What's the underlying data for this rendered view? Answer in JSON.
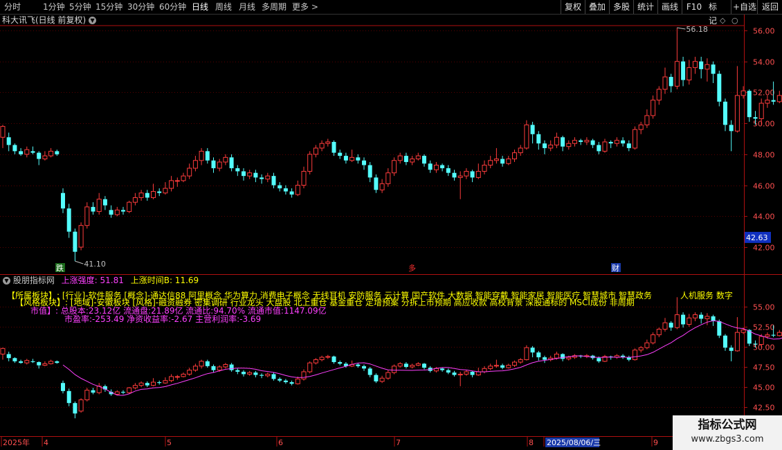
{
  "toolbar": {
    "periods": [
      "分时",
      "1分钟",
      "5分钟",
      "15分钟",
      "30分钟",
      "60分钟",
      "日线",
      "周线",
      "月线",
      "多周期",
      "更多 >"
    ],
    "active_period": "日线",
    "right_buttons": [
      "复权",
      "叠加",
      "多股",
      "统计",
      "画线",
      "F10",
      "+自选",
      "返回"
    ],
    "mark_label": "标记"
  },
  "stock_title": "科大讯飞(日线 前复权)",
  "price_axis": [
    "56.00",
    "54.00",
    "52.00",
    "50.00",
    "48.00",
    "46.00",
    "44.00",
    "42.00"
  ],
  "current_price": "42.63",
  "high_label": "56.18",
  "low_label": "41.10",
  "markers": {
    "die": "跌",
    "lang": "多",
    "cai": "财"
  },
  "indicator": {
    "name": "股朋指标网",
    "v1_label": "上涨强度: 51.81",
    "v2_label": "上涨时间B: 11.69"
  },
  "info": {
    "line1_label": "【所属板块】:",
    "line1_text": "[行业]-软件服务 [概念]-通达信88 阿里概念 华为算力 消费电子概念 无线耳机 安防服务 云计算 国产软件 大数据 智能穿戴 智能家居 智能医疗 智慧城市 智慧政务",
    "line1_right": "人机服务 数字",
    "line2_label": "【风格板块】:",
    "line2_text": "[地域]-安徽板块 [风格]-融资融券 密集调研 行业龙头 大盘股 北上重仓 基金重仓 定增预案 分拆上市预期 高应收款 高校背景 深股通标的 MSCI成份 非周期",
    "line3_label": "市值】:",
    "line3_text": "总股本:23.12亿 流通盘:21.89亿 流通比:94.70% 流通市值:1147.09亿",
    "line4_text": "市盈率:-253.49 净资收益率:-2.67 主营利润率:-3.69"
  },
  "indicator_axis": [
    "55.00",
    "52.50",
    "50.00",
    "47.50",
    "45.00",
    "42.50"
  ],
  "dates": [
    "2025年",
    "4",
    "5",
    "6",
    "7",
    "8",
    "2025/08/06/三",
    "9"
  ],
  "watermark": {
    "title": "指标公式网",
    "url": "www.zbgs3.com"
  },
  "colors": {
    "up": "#ff3c3c",
    "down": "#54fcfc",
    "ma": "#ff40ff",
    "axis": "#b01010",
    "yellow": "#ffff00"
  },
  "chart_data": {
    "type": "candlestick",
    "ylim": [
      41.0,
      56.7
    ],
    "candles": [
      [
        49.1,
        49.8,
        49.9,
        48.4
      ],
      [
        49.1,
        48.6,
        49.4,
        48.2
      ],
      [
        48.6,
        48.2,
        48.7,
        48.0
      ],
      [
        48.2,
        48.0,
        48.4,
        47.9
      ],
      [
        48.0,
        48.3,
        48.5,
        47.8
      ],
      [
        48.2,
        48.1,
        48.5,
        48.0
      ],
      [
        48.1,
        47.7,
        48.2,
        47.3
      ],
      [
        47.7,
        47.9,
        48.2,
        47.6
      ],
      [
        47.9,
        48.2,
        48.4,
        47.8
      ],
      [
        48.2,
        48.0,
        48.3,
        47.9
      ],
      [
        45.5,
        44.5,
        45.8,
        44.2
      ],
      [
        44.5,
        43.0,
        44.8,
        42.6
      ],
      [
        43.0,
        41.7,
        43.2,
        41.1
      ],
      [
        42.0,
        43.4,
        43.6,
        41.8
      ],
      [
        43.4,
        44.6,
        44.9,
        43.2
      ],
      [
        44.6,
        44.3,
        44.9,
        44.1
      ],
      [
        44.3,
        45.1,
        45.5,
        44.1
      ],
      [
        45.1,
        44.7,
        45.3,
        44.4
      ],
      [
        44.4,
        44.1,
        44.7,
        43.9
      ],
      [
        44.1,
        44.4,
        44.6,
        44.0
      ],
      [
        44.4,
        44.3,
        44.6,
        44.1
      ],
      [
        44.3,
        44.9,
        45.0,
        44.2
      ],
      [
        44.9,
        45.2,
        45.5,
        44.7
      ],
      [
        45.2,
        45.5,
        45.7,
        45.0
      ],
      [
        45.5,
        45.2,
        45.7,
        45.0
      ],
      [
        45.2,
        45.6,
        46.1,
        45.1
      ],
      [
        45.6,
        45.5,
        45.8,
        45.3
      ],
      [
        45.5,
        45.8,
        46.2,
        45.4
      ],
      [
        45.8,
        46.3,
        46.6,
        45.6
      ],
      [
        46.3,
        46.3,
        46.5,
        45.9
      ],
      [
        46.3,
        46.6,
        46.8,
        46.2
      ],
      [
        46.6,
        47.1,
        47.4,
        46.4
      ],
      [
        47.1,
        47.6,
        47.9,
        46.9
      ],
      [
        47.6,
        48.2,
        48.4,
        47.3
      ],
      [
        48.2,
        47.6,
        48.4,
        47.4
      ],
      [
        47.6,
        47.1,
        47.8,
        46.8
      ],
      [
        47.1,
        47.5,
        47.7,
        46.9
      ],
      [
        47.5,
        47.8,
        48.0,
        47.3
      ],
      [
        47.8,
        47.1,
        48.0,
        46.9
      ],
      [
        47.1,
        46.9,
        47.3,
        46.6
      ],
      [
        46.9,
        46.6,
        47.1,
        46.3
      ],
      [
        46.6,
        46.8,
        47.0,
        46.4
      ],
      [
        46.8,
        46.5,
        47.0,
        46.2
      ],
      [
        46.5,
        46.4,
        46.7,
        46.1
      ],
      [
        46.4,
        46.6,
        46.8,
        46.2
      ],
      [
        46.6,
        46.0,
        46.8,
        45.8
      ],
      [
        46.0,
        45.8,
        46.2,
        45.6
      ],
      [
        45.8,
        45.6,
        46.0,
        45.4
      ],
      [
        45.6,
        45.4,
        45.8,
        45.2
      ],
      [
        45.4,
        46.0,
        46.3,
        45.3
      ],
      [
        46.0,
        46.9,
        47.2,
        45.8
      ],
      [
        46.9,
        48.0,
        48.2,
        46.7
      ],
      [
        48.0,
        48.4,
        48.6,
        47.8
      ],
      [
        48.4,
        48.7,
        48.9,
        48.2
      ],
      [
        48.7,
        48.8,
        49.0,
        48.5
      ],
      [
        48.8,
        48.1,
        48.9,
        47.9
      ],
      [
        48.1,
        47.9,
        48.3,
        47.7
      ],
      [
        47.9,
        47.6,
        48.1,
        47.4
      ],
      [
        47.6,
        47.8,
        48.3,
        47.5
      ],
      [
        47.8,
        47.6,
        48.0,
        47.4
      ],
      [
        47.6,
        47.3,
        47.8,
        47.0
      ],
      [
        47.3,
        46.5,
        47.5,
        46.2
      ],
      [
        46.5,
        45.7,
        46.7,
        45.5
      ],
      [
        45.7,
        46.1,
        46.4,
        45.5
      ],
      [
        46.1,
        46.8,
        47.1,
        45.9
      ],
      [
        46.8,
        47.6,
        47.8,
        46.6
      ],
      [
        47.6,
        47.9,
        48.1,
        47.4
      ],
      [
        47.9,
        47.5,
        48.1,
        47.3
      ],
      [
        47.5,
        47.7,
        47.9,
        47.3
      ],
      [
        47.7,
        47.9,
        48.1,
        47.6
      ],
      [
        47.9,
        47.4,
        48.0,
        47.2
      ],
      [
        47.4,
        47.0,
        47.6,
        46.8
      ],
      [
        47.0,
        47.3,
        47.5,
        46.8
      ],
      [
        47.3,
        47.1,
        47.4,
        46.9
      ],
      [
        47.1,
        46.8,
        47.3,
        46.6
      ],
      [
        46.8,
        46.5,
        47.0,
        46.3
      ],
      [
        46.5,
        46.6,
        46.9,
        45.1
      ],
      [
        46.6,
        46.9,
        47.1,
        46.4
      ],
      [
        46.9,
        46.5,
        47.0,
        46.2
      ],
      [
        46.5,
        46.9,
        47.4,
        46.4
      ],
      [
        46.9,
        47.3,
        47.6,
        46.7
      ],
      [
        47.3,
        47.6,
        47.9,
        47.1
      ],
      [
        47.6,
        47.7,
        48.4,
        47.4
      ],
      [
        47.7,
        47.4,
        47.9,
        47.2
      ],
      [
        47.4,
        47.7,
        47.9,
        47.3
      ],
      [
        47.7,
        48.1,
        48.3,
        47.5
      ],
      [
        48.1,
        48.4,
        48.6,
        47.9
      ],
      [
        48.4,
        49.9,
        50.2,
        48.3
      ],
      [
        49.9,
        49.3,
        50.1,
        48.7
      ],
      [
        49.3,
        48.7,
        49.5,
        48.3
      ],
      [
        48.7,
        48.4,
        48.9,
        48.0
      ],
      [
        48.4,
        48.6,
        48.9,
        48.2
      ],
      [
        48.6,
        49.1,
        49.4,
        48.4
      ],
      [
        49.1,
        48.5,
        49.2,
        48.2
      ],
      [
        48.5,
        48.7,
        48.9,
        48.3
      ],
      [
        48.7,
        48.9,
        49.1,
        48.5
      ],
      [
        48.9,
        48.8,
        49.0,
        48.6
      ],
      [
        48.8,
        48.9,
        49.1,
        48.6
      ],
      [
        48.9,
        48.6,
        49.0,
        48.4
      ],
      [
        48.6,
        48.2,
        48.8,
        48.0
      ],
      [
        48.2,
        48.8,
        49.0,
        48.1
      ],
      [
        48.8,
        48.7,
        48.9,
        48.4
      ],
      [
        48.7,
        48.9,
        49.1,
        48.5
      ],
      [
        48.9,
        48.7,
        49.1,
        48.5
      ],
      [
        48.7,
        48.4,
        48.9,
        48.2
      ],
      [
        48.4,
        49.6,
        49.8,
        48.3
      ],
      [
        49.6,
        49.9,
        50.1,
        49.3
      ],
      [
        49.9,
        50.5,
        50.9,
        49.7
      ],
      [
        50.5,
        51.5,
        51.8,
        50.3
      ],
      [
        51.5,
        52.2,
        52.4,
        51.2
      ],
      [
        52.2,
        53.0,
        53.6,
        51.9
      ],
      [
        53.0,
        52.4,
        53.2,
        52.0
      ],
      [
        52.4,
        54.0,
        56.18,
        52.2
      ],
      [
        54.0,
        52.8,
        54.3,
        52.4
      ],
      [
        52.8,
        53.6,
        54.1,
        52.5
      ],
      [
        53.6,
        54.0,
        54.3,
        53.2
      ],
      [
        54.0,
        53.5,
        54.3,
        52.9
      ],
      [
        53.5,
        53.8,
        54.2,
        52.7
      ],
      [
        53.8,
        53.2,
        54.0,
        52.6
      ],
      [
        53.2,
        51.4,
        53.4,
        51.1
      ],
      [
        51.4,
        49.9,
        51.6,
        49.5
      ],
      [
        49.9,
        49.5,
        50.2,
        48.2
      ],
      [
        49.5,
        51.8,
        53.7,
        49.4
      ],
      [
        51.8,
        52.1,
        52.4,
        51.6
      ],
      [
        52.1,
        50.4,
        52.2,
        50.1
      ],
      [
        50.4,
        50.3,
        50.8,
        49.9
      ],
      [
        50.3,
        51.3,
        51.6,
        49.9
      ],
      [
        51.3,
        51.5,
        51.8,
        51.0
      ],
      [
        51.5,
        51.4,
        52.7,
        51.2
      ],
      [
        51.4,
        51.8,
        52.1,
        51.3
      ],
      [
        51.8,
        52.3,
        52.6,
        51.6
      ],
      [
        52.3,
        52.4,
        52.7,
        51.9
      ]
    ]
  }
}
